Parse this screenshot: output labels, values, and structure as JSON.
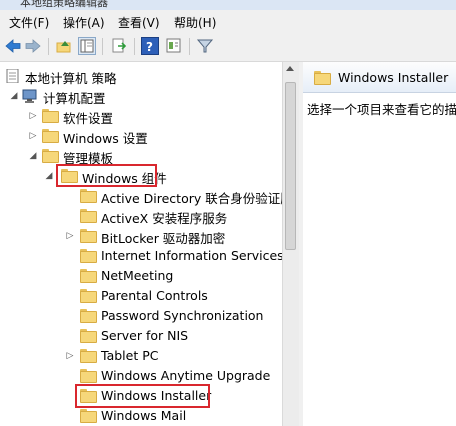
{
  "window": {
    "title": "本地组策略编辑器"
  },
  "menu": [
    "文件(F)",
    "操作(A)",
    "查看(V)",
    "帮助(H)"
  ],
  "toolbar": {
    "icons": [
      "back-arrow-icon",
      "forward-arrow-icon",
      "up-folder-icon",
      "show-hide-tree-icon",
      "export-list-icon",
      "help-icon",
      "properties-icon",
      "filter-icon"
    ]
  },
  "tree": {
    "root": "本地计算机 策略",
    "computer_config": "计算机配置",
    "software_settings": "软件设置",
    "windows_settings": "Windows 设置",
    "admin_templates": "管理模板",
    "windows_components": "Windows 组件",
    "items": [
      "Active Directory 联合身份验证服",
      "ActiveX 安装程序服务",
      "BitLocker 驱动器加密",
      "Internet Information Services",
      "NetMeeting",
      "Parental Controls",
      "Password Synchronization",
      "Server for NIS",
      "Tablet PC",
      "Windows Anytime Upgrade",
      "Windows Installer",
      "Windows Mail"
    ]
  },
  "right_panel": {
    "header": "Windows Installer",
    "description": "选择一个项目来查看它的描述"
  },
  "colors": {
    "highlight_border": "#d9272e",
    "folder": "#f6d77a"
  }
}
